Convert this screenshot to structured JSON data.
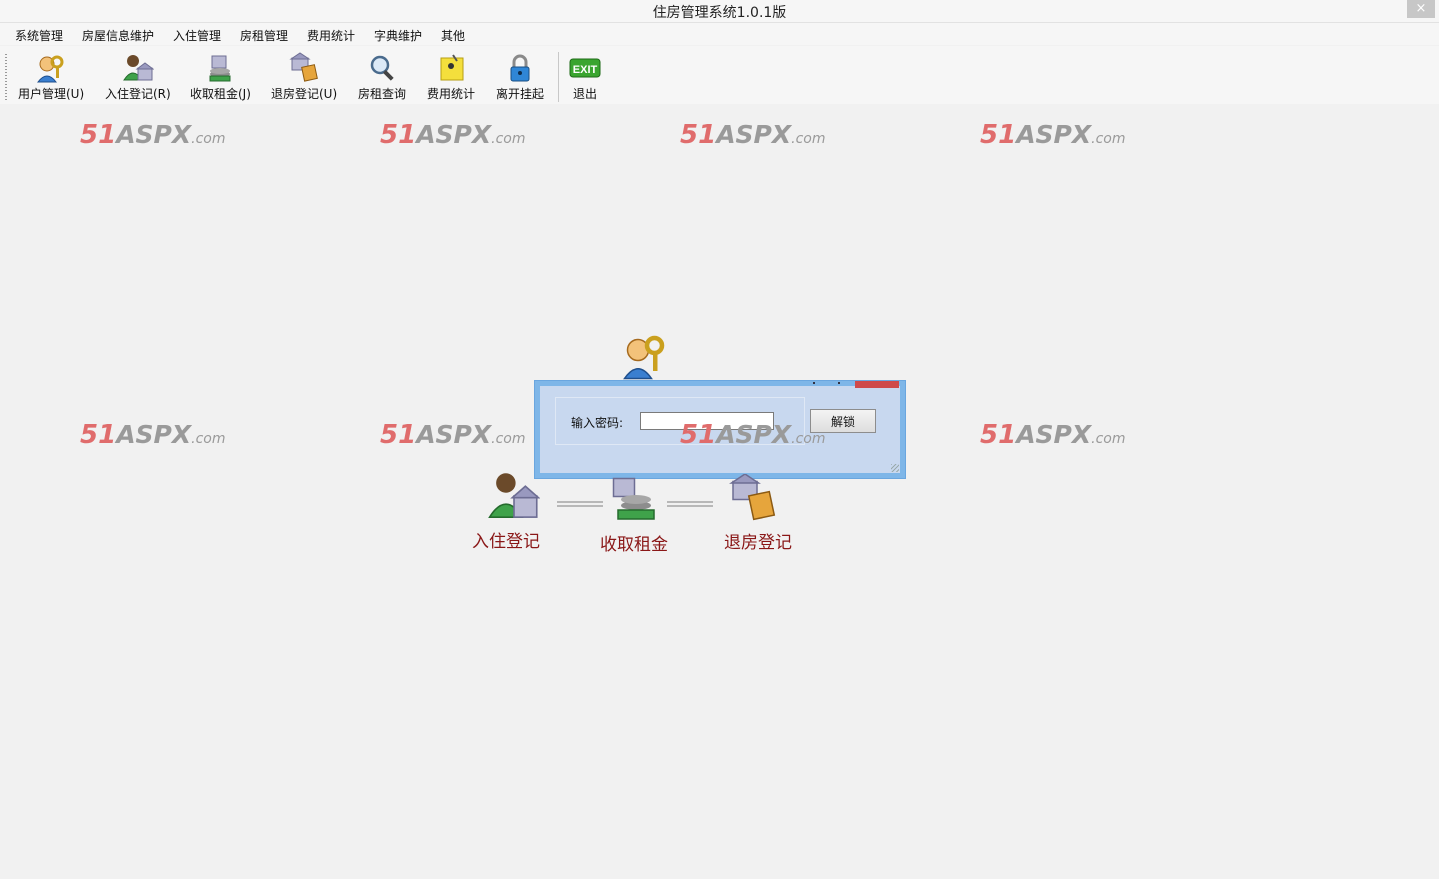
{
  "window": {
    "title": "住房管理系统1.0.1版",
    "close_label": "×"
  },
  "menu": [
    "系统管理",
    "房屋信息维护",
    "入住管理",
    "房租管理",
    "费用统计",
    "字典维护",
    "其他"
  ],
  "toolbar": [
    {
      "label": "用户管理(U)",
      "icon": "user-key-icon"
    },
    {
      "label": "入住登记(R)",
      "icon": "checkin-icon"
    },
    {
      "label": "收取租金(J)",
      "icon": "rent-coins-icon"
    },
    {
      "label": "退房登记(U)",
      "icon": "checkout-icon"
    },
    {
      "label": "房租查询",
      "icon": "magnifier-icon"
    },
    {
      "label": "费用统计",
      "icon": "note-pin-icon"
    },
    {
      "label": "离开挂起",
      "icon": "lock-icon"
    },
    {
      "label": "退出",
      "icon": "exit-icon"
    }
  ],
  "watermark": {
    "num": "51",
    "brand": "ASPX",
    "suffix": ".com"
  },
  "lock_dialog": {
    "password_label": "输入密码:",
    "password_value": "",
    "unlock_button": "解锁"
  },
  "flow": [
    "入住登记",
    "收取租金",
    "退房登记"
  ],
  "colors": {
    "accent": "#6aa6df",
    "flow_text": "#8a1717",
    "watermark_red": "#e06c6c"
  }
}
